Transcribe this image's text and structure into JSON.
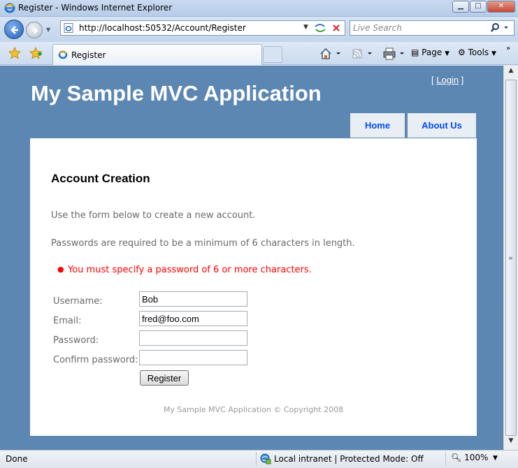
{
  "window": {
    "title": "Register - Windows Internet Explorer",
    "minimize_icon": "minimize-icon",
    "maximize_icon": "maximize-icon",
    "close_icon": "close-icon"
  },
  "navigation": {
    "address": "http://localhost:50532/Account/Register",
    "search_placeholder": "Live Search"
  },
  "tabs": [
    {
      "label": "Register",
      "icon": "ie-page-icon",
      "active": true
    }
  ],
  "command_bar": {
    "page_label": "Page",
    "tools_label": "Tools"
  },
  "site": {
    "title": "My Sample MVC Application",
    "login_open": "[ ",
    "login_label": "Login",
    "login_close": " ]",
    "menu": [
      {
        "label": "Home"
      },
      {
        "label": "About Us"
      }
    ],
    "colors": {
      "header_bg": "#5c87b2",
      "menu_tab_bg": "#e8eef4",
      "menu_link": "#034af3",
      "error": "#ff0000"
    }
  },
  "form": {
    "heading": "Account Creation",
    "intro": "Use the form below to create a new account.",
    "password_note": "Passwords are required to be a minimum of 6 characters in length.",
    "errors": [
      "You must specify a password of 6 or more characters."
    ],
    "fields": {
      "username": {
        "label": "Username:",
        "value": "Bob"
      },
      "email": {
        "label": "Email:",
        "value": "fred@foo.com"
      },
      "password": {
        "label": "Password:",
        "value": ""
      },
      "confirm": {
        "label": "Confirm password:",
        "value": ""
      }
    },
    "submit_label": "Register",
    "footer": "My Sample MVC Application © Copyright 2008"
  },
  "status": {
    "text": "Done",
    "zone": "Local intranet | Protected Mode: Off",
    "zoom": "100%"
  }
}
